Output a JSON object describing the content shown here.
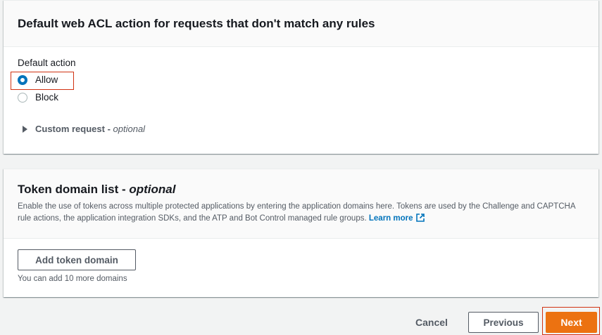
{
  "default_action_panel": {
    "title": "Default web ACL action for requests that don't match any rules",
    "field_label": "Default action",
    "options": [
      {
        "label": "Allow",
        "selected": true
      },
      {
        "label": "Block",
        "selected": false
      }
    ],
    "expander": {
      "label": "Custom request - ",
      "optional": "optional",
      "icon": "caret-right-icon"
    }
  },
  "token_panel": {
    "title": "Token domain list - ",
    "title_optional": "optional",
    "description": "Enable the use of tokens across multiple protected applications by entering the application domains here. Tokens are used by the Challenge and CAPTCHA rule actions, the application integration SDKs, and the ATP and Bot Control managed rule groups.",
    "learn_more": "Learn more",
    "learn_more_icon": "external-link-icon",
    "add_button": "Add token domain",
    "hint": "You can add 10 more domains"
  },
  "footer": {
    "cancel": "Cancel",
    "previous": "Previous",
    "next": "Next"
  },
  "colors": {
    "primary": "#ec7211",
    "link": "#0073bb",
    "highlight": "#d13212"
  }
}
